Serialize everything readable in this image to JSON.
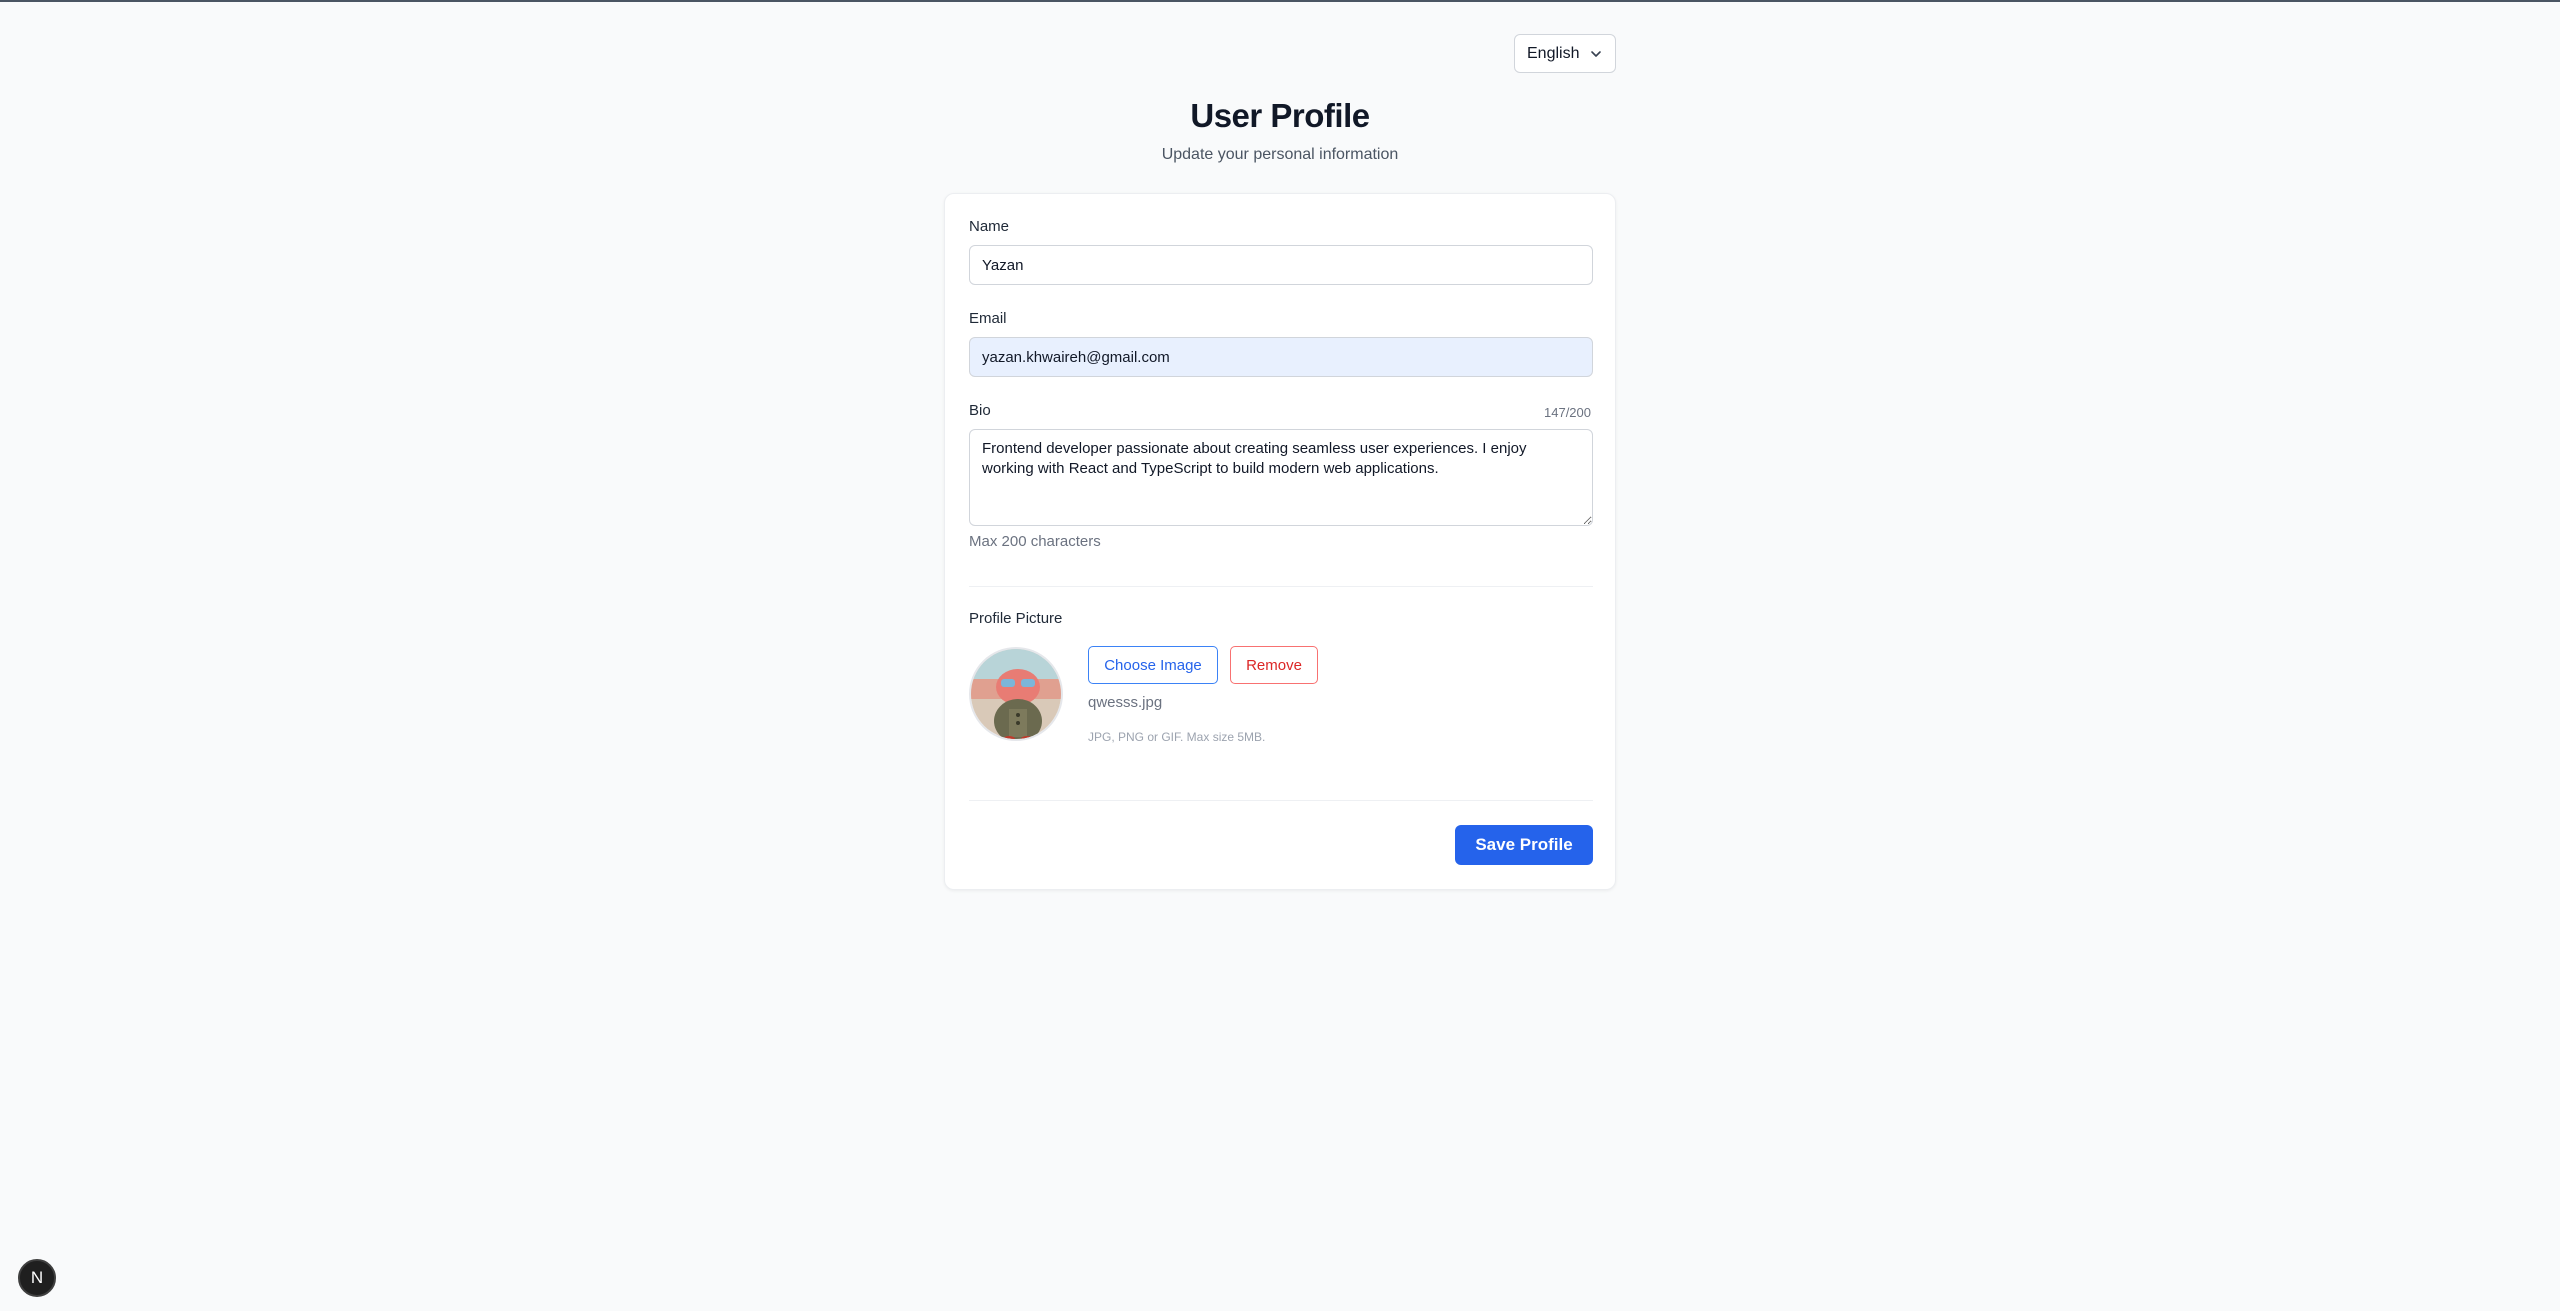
{
  "language": {
    "selected": "English",
    "icon": "chevron-down-icon"
  },
  "header": {
    "title": "User Profile",
    "subtitle": "Update your personal information"
  },
  "form": {
    "name": {
      "label": "Name",
      "value": "Yazan"
    },
    "email": {
      "label": "Email",
      "value": "yazan.khwaireh@gmail.com"
    },
    "bio": {
      "label": "Bio",
      "counter": "147/200",
      "value": "Frontend developer passionate about creating seamless user experiences. I enjoy working with React and TypeScript to build modern web applications.",
      "hint": "Max 200 characters"
    },
    "picture": {
      "label": "Profile Picture",
      "choose_label": "Choose Image",
      "remove_label": "Remove",
      "filename": "qwesss.jpg",
      "hint": "JPG, PNG or GIF. Max size 5MB."
    },
    "save_label": "Save Profile"
  },
  "dev_badge": {
    "label": "N"
  },
  "colors": {
    "primary": "#2563eb",
    "danger": "#dc2626",
    "background": "#f9fafb",
    "autofill": "#e8f0fe"
  }
}
